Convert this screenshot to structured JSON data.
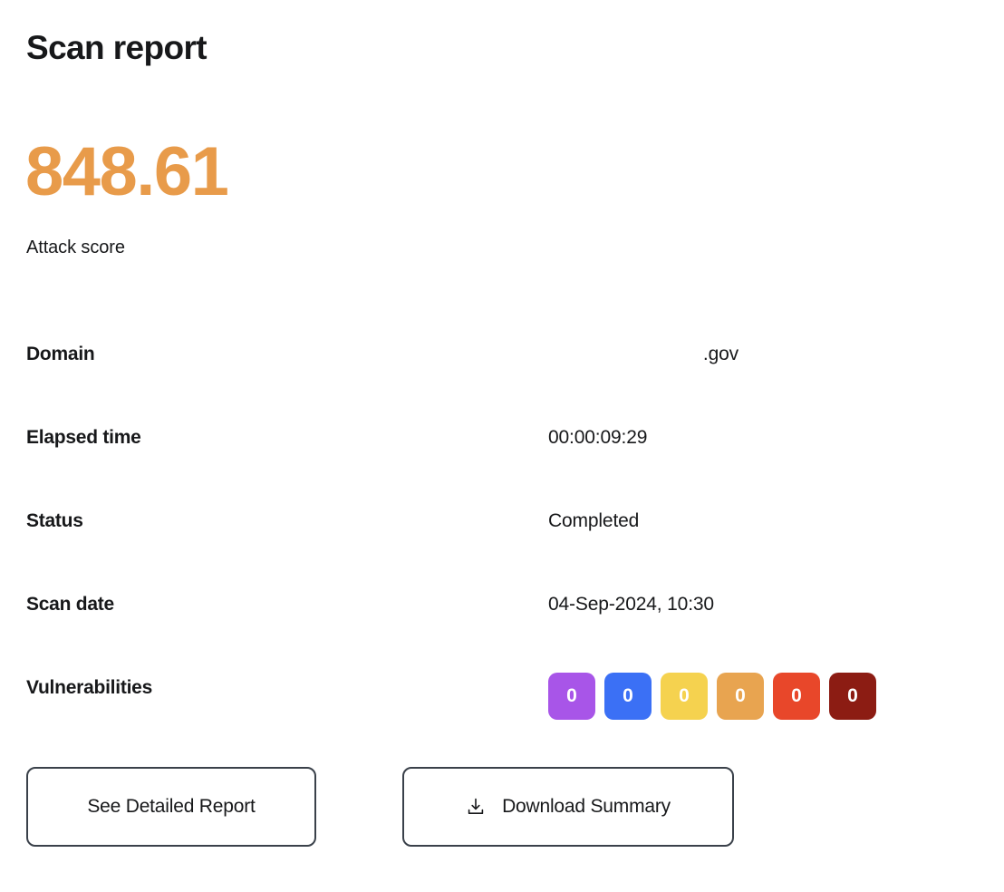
{
  "header": {
    "title": "Scan report"
  },
  "score": {
    "value": "848.61",
    "label": "Attack score",
    "color": "#e89b4a"
  },
  "details": {
    "rows": [
      {
        "label": "Domain",
        "value": ".gov"
      },
      {
        "label": "Elapsed time",
        "value": "00:00:09:29"
      },
      {
        "label": "Status",
        "value": "Completed"
      },
      {
        "label": "Scan date",
        "value": "04-Sep-2024, 10:30"
      }
    ],
    "vulnerabilities": {
      "label": "Vulnerabilities",
      "badges": [
        {
          "count": "0",
          "color": "#a855e8"
        },
        {
          "count": "0",
          "color": "#3b70f5"
        },
        {
          "count": "0",
          "color": "#f5d24f"
        },
        {
          "count": "0",
          "color": "#e8a450"
        },
        {
          "count": "0",
          "color": "#e8472a"
        },
        {
          "count": "0",
          "color": "#8c1c13"
        }
      ]
    }
  },
  "actions": {
    "detailed_report_label": "See Detailed Report",
    "download_summary_label": "Download Summary",
    "download_icon": "download-icon"
  }
}
